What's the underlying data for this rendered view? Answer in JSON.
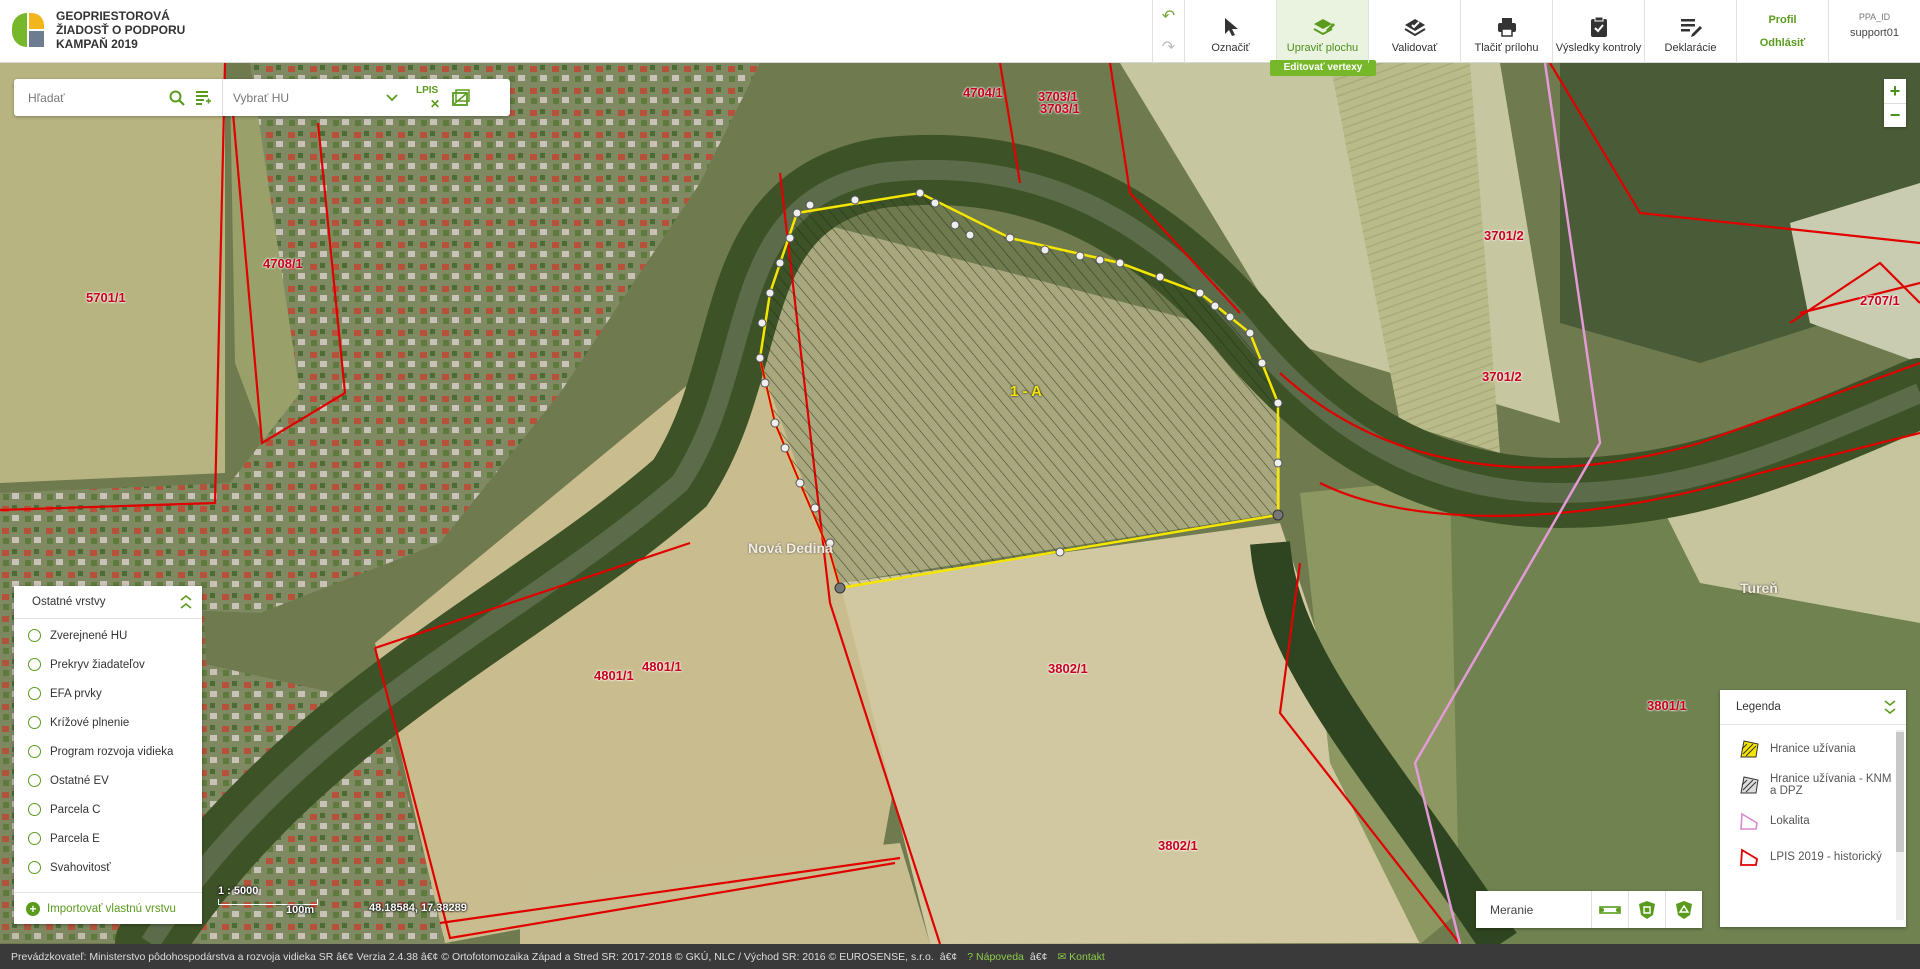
{
  "header": {
    "brand_line1": "GEOPRIESTOROVÁ",
    "brand_line2": "ŽIADOSŤ O PODPORU",
    "brand_line3": "KAMPAŇ 2019",
    "tools": [
      {
        "label": "Označiť",
        "icon": "cursor-icon"
      },
      {
        "label": "Upraviť plochu",
        "icon": "edit-area-icon",
        "active": true
      },
      {
        "label": "Validovať",
        "icon": "validate-icon"
      },
      {
        "label": "Tlačiť prílohu",
        "icon": "printer-icon"
      },
      {
        "label": "Výsledky kontroly",
        "icon": "clipboard-check-icon"
      },
      {
        "label": "Deklarácie",
        "icon": "declaration-icon"
      }
    ],
    "active_sub_label": "Editovať vertexy",
    "profile_label": "Profil",
    "logout_label": "Odhlásiť",
    "user_id_label": "PPA_ID",
    "user_name": "support01"
  },
  "search": {
    "placeholder": "Hľadať",
    "hu_placeholder": "Vybrať HU",
    "lpis_label": "LPIS"
  },
  "map": {
    "parcel_labels": [
      "4708/1",
      "5701/1",
      "4704/1",
      "3703/1",
      "3703/1",
      "3701/2",
      "3701/2",
      "2707/1",
      "4801/1",
      "4801/1",
      "3802/1",
      "3802/1",
      "3801/1",
      "06/"
    ],
    "selected_parcel_label": "1 - A",
    "place_labels": [
      "Nová Dedina",
      "Tureň"
    ],
    "scale_text": "1 : 5000",
    "scale_distance": "100m",
    "coordinates": "48.18584, 17.38289"
  },
  "layers": {
    "title": "Ostatné vrstvy",
    "items": [
      "Zverejnené HU",
      "Prekryv žiadateľov",
      "EFA prvky",
      "Krížové plnenie",
      "Program rozvoja vidieka",
      "Ostatné EV",
      "Parcela C",
      "Parcela E",
      "Svahovitosť"
    ],
    "import_label": "Importovať vlastnú vrstvu"
  },
  "legend": {
    "title": "Legenda",
    "items": [
      "Hranice užívania",
      "Hranice užívania - KNM a DPZ",
      "Lokalita",
      "LPIS 2019 - historický"
    ]
  },
  "measure": {
    "label": "Meranie"
  },
  "footer": {
    "text": "Prevádzkovateľ: Ministerstvo pôdohospodárstva a rozvoja vidieka SR â€¢ Verzia 2.4.38 â€¢ © Ortofotomozaika Západ a Stred SR: 2017-2018 © GKÚ, NLC / Východ SR: 2016 © EUROSENSE, s.r.o.",
    "sep": "â€¢",
    "help_label": "? Nápoveda",
    "contact_label": "Kontakt"
  },
  "colors": {
    "accent": "#76b82a",
    "parcel_border": "#e10000",
    "selected_border": "#f5e600"
  }
}
